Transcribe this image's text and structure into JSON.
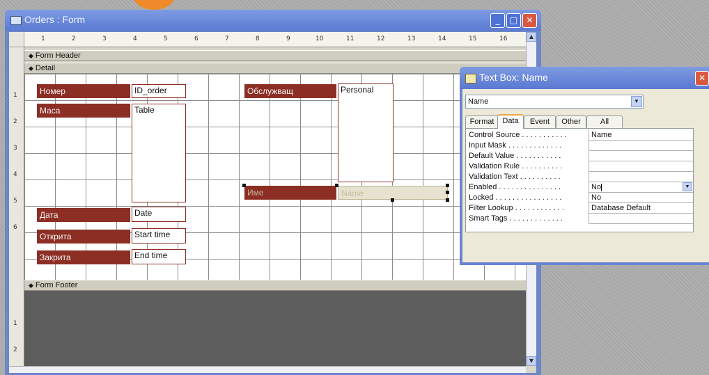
{
  "window": {
    "title": "Orders : Form"
  },
  "ruler": {
    "h_ticks": [
      "1",
      "2",
      "3",
      "4",
      "5",
      "6",
      "7",
      "8",
      "9",
      "10",
      "11",
      "12",
      "13",
      "14",
      "15",
      "16"
    ],
    "v_ticks": [
      "1",
      "2",
      "3",
      "4",
      "5",
      "6",
      "1",
      "2"
    ]
  },
  "sections": {
    "header": "Form Header",
    "detail": "Detail",
    "footer": "Form Footer"
  },
  "controls": {
    "nomer_label": "Номер",
    "nomer_value": "ID_order",
    "masa_label": "Маса",
    "masa_value": "Table",
    "data_label": "Дата",
    "data_value": "Date",
    "otkrita_label": "Открита",
    "otkrita_value": "Start time",
    "zakrita_label": "Закрита",
    "zakrita_value": "End time",
    "obsluzhvasht_label": "Обслужващ",
    "obsluzhvasht_value": "Personal",
    "ime_label": "Име",
    "ime_value": "Name"
  },
  "property_sheet": {
    "title": "Text Box: Name",
    "selected_object": "Name",
    "tabs": [
      "Format",
      "Data",
      "Event",
      "Other",
      "All"
    ],
    "active_tab": "Data",
    "rows": [
      {
        "name": "Control Source . . . . . . . . . . .",
        "value": "Name"
      },
      {
        "name": "Input Mask . . . . . . . . . . . . .",
        "value": ""
      },
      {
        "name": "Default Value . . . . . . . . . . .",
        "value": ""
      },
      {
        "name": "Validation Rule . . . . . . . . . .",
        "value": ""
      },
      {
        "name": "Validation Text . . . . . . . . . .",
        "value": ""
      },
      {
        "name": "Enabled . . . . . . . . . . . . . . .",
        "value": "No"
      },
      {
        "name": "Locked . . . . . . . . . . . . . . . .",
        "value": "No"
      },
      {
        "name": "Filter Lookup . . . . . . . . . . . .",
        "value": "Database Default"
      },
      {
        "name": "Smart Tags . . . . . . . . . . . . .",
        "value": ""
      }
    ]
  },
  "colors": {
    "label_bg": "#8c2e24",
    "titlebar": "#5c7bd4",
    "footer_bg": "#5d5d5d"
  }
}
